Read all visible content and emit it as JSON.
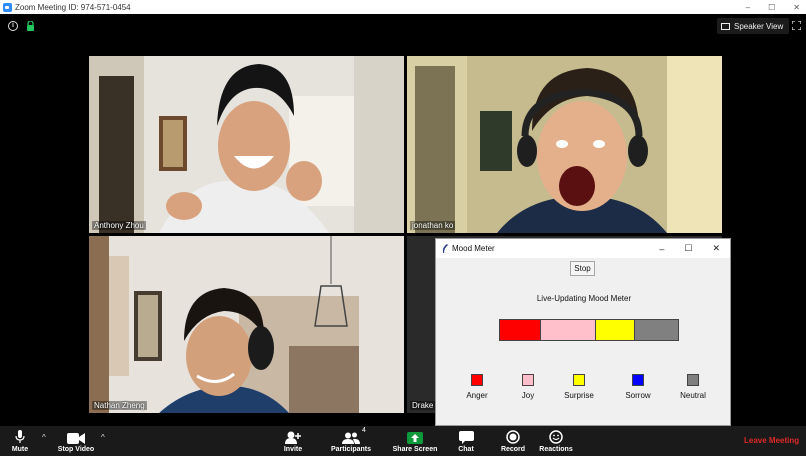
{
  "window": {
    "title": "Zoom Meeting ID: 974-571-0454",
    "controls": [
      "–",
      "☐",
      "✕"
    ]
  },
  "top": {
    "speaker_view_label": "Speaker View"
  },
  "participants": [
    {
      "name": "Anthony Zhou"
    },
    {
      "name": "jonathan ko"
    },
    {
      "name": "Nathan Zheng"
    },
    {
      "name": "Drake L"
    }
  ],
  "mood_meter": {
    "title": "Mood Meter",
    "controls": [
      "–",
      "☐",
      "✕"
    ],
    "stop_label": "Stop",
    "heading": "Live-Updating Mood Meter",
    "bar_segments": [
      {
        "mood": "Anger",
        "fraction": 0.233,
        "color": "#ff0000"
      },
      {
        "mood": "Joy",
        "fraction": 0.306,
        "color": "#ffbfcb"
      },
      {
        "mood": "Surprise",
        "fraction": 0.222,
        "color": "#ffff00"
      },
      {
        "mood": "Neutral",
        "fraction": 0.239,
        "color": "#808080"
      }
    ],
    "legend": [
      {
        "label": "Anger",
        "color": "#ff0000"
      },
      {
        "label": "Joy",
        "color": "#ffbfcb"
      },
      {
        "label": "Surprise",
        "color": "#ffff00"
      },
      {
        "label": "Sorrow",
        "color": "#0000ff"
      },
      {
        "label": "Neutral",
        "color": "#808080"
      }
    ]
  },
  "toolbar": {
    "mute": "Mute",
    "stop_video": "Stop Video",
    "invite": "Invite",
    "participants": "Participants",
    "participants_count": "4",
    "share_screen": "Share Screen",
    "chat": "Chat",
    "record": "Record",
    "reactions": "Reactions",
    "leave": "Leave Meeting",
    "share_color": "#0e9a3a",
    "leave_color": "#e02828"
  }
}
